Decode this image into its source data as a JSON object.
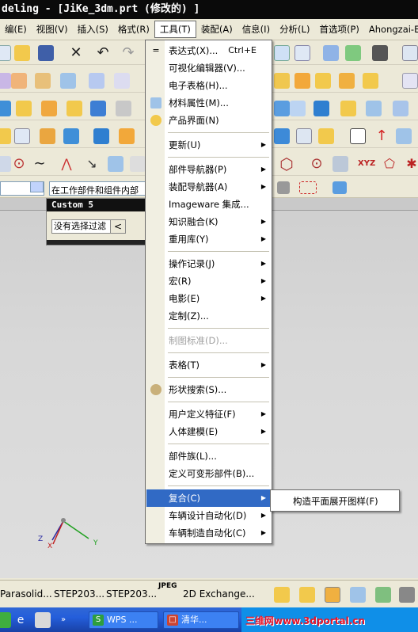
{
  "window": {
    "title": "deling - [JiKe_3dm.prt  (修改的) ]"
  },
  "menubar": {
    "items": [
      "编(E)",
      "视图(V)",
      "插入(S)",
      "格式(R)",
      "工具(T)",
      "装配(A)",
      "信息(I)",
      "分析(L)",
      "首选项(P)",
      "Ahongzai-EDM"
    ],
    "active": "工具(T)"
  },
  "filterbar": {
    "scope_value": "在工作部件和组件内部"
  },
  "custom_panel": {
    "title": "Custom 5",
    "field_value": "没有选择过滤",
    "back_glyph": "<"
  },
  "tools_menu": {
    "items": [
      {
        "label": "表达式(X)...",
        "shortcut": "Ctrl+E",
        "icon": "equals-icon"
      },
      {
        "label": "可视化编辑器(V)..."
      },
      {
        "label": "电子表格(H)..."
      },
      {
        "label": "材料属性(M)...",
        "icon": "material-icon"
      },
      {
        "label": "产品界面(N)",
        "icon": "product-interface-icon"
      },
      {
        "label": "更新(U)",
        "submenu": true
      },
      {
        "label": "部件导航器(P)",
        "submenu": true
      },
      {
        "label": "装配导航器(A)",
        "submenu": true
      },
      {
        "label": "Imageware 集成..."
      },
      {
        "label": "知识融合(K)",
        "submenu": true
      },
      {
        "label": "重用库(Y)",
        "submenu": true
      },
      {
        "label": "操作记录(J)",
        "submenu": true
      },
      {
        "label": "宏(R)",
        "submenu": true
      },
      {
        "label": "电影(E)",
        "submenu": true
      },
      {
        "label": "定制(Z)..."
      },
      {
        "label": "制图标准(D)...",
        "disabled": true
      },
      {
        "label": "表格(T)",
        "submenu": true
      },
      {
        "label": "形状搜索(S)...",
        "icon": "shape-search-icon"
      },
      {
        "label": "用户定义特征(F)",
        "submenu": true
      },
      {
        "label": "人体建模(E)",
        "submenu": true
      },
      {
        "label": "部件族(L)..."
      },
      {
        "label": "定义可变形部件(B)..."
      },
      {
        "label": "复合(C)",
        "submenu": true,
        "highlighted": true
      },
      {
        "label": "车辆设计自动化(D)",
        "submenu": true
      },
      {
        "label": "车辆制造自动化(C)",
        "submenu": true
      }
    ]
  },
  "composite_submenu": {
    "items": [
      "构造平面展开图样(F)"
    ]
  },
  "triad": {
    "x": "X",
    "y": "Y",
    "z": "Z"
  },
  "bottom_toolbar": {
    "items": [
      "Parasolid...",
      "STEP203...",
      "STEP203...",
      "JPEG",
      "2D Exchange..."
    ]
  },
  "taskbar": {
    "buttons": [
      "WPS ...",
      "清华..."
    ],
    "watermark": "三维网www.3dportal.cn"
  },
  "colors": {
    "menu_highlight": "#316ac5",
    "title_bg": "#0a0a0a",
    "taskbar": "#245edb"
  }
}
